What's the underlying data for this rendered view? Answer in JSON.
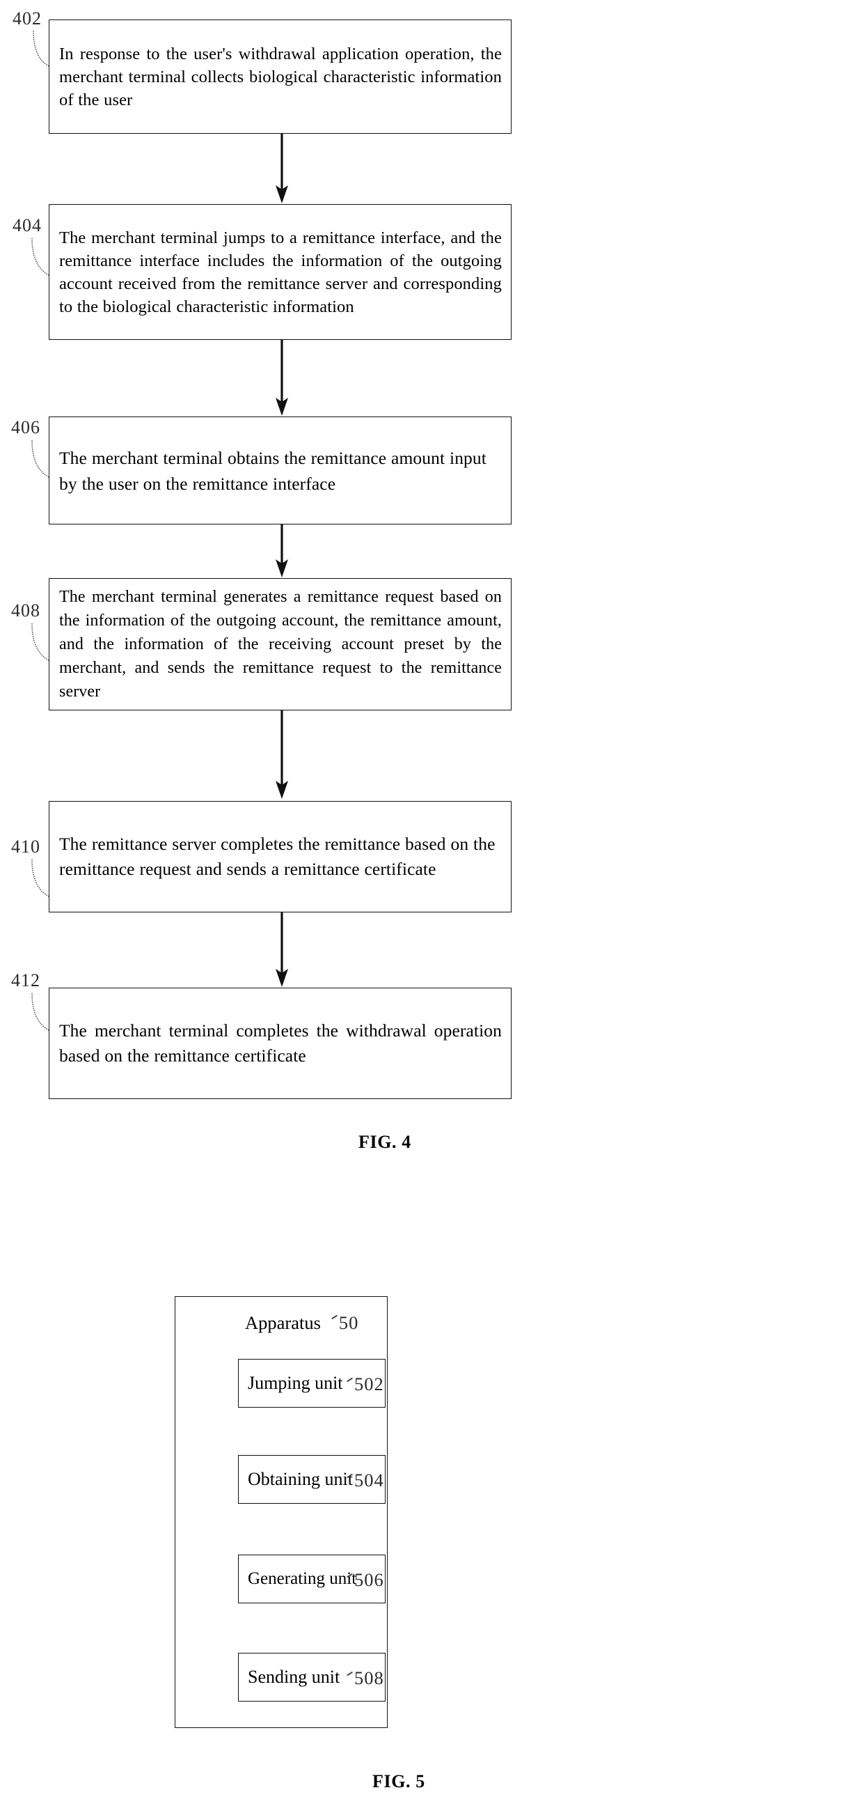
{
  "figure4": {
    "caption": "FIG. 4",
    "steps": [
      {
        "ref": "402",
        "text": "In response to the user's withdrawal application operation, the merchant terminal collects biological characteristic information of the user"
      },
      {
        "ref": "404",
        "text": "The merchant terminal jumps to a remittance interface, and the remittance interface includes the information of the outgoing account received from the remittance server and corresponding to the biological characteristic information"
      },
      {
        "ref": "406",
        "text": "The merchant terminal obtains the remittance amount input by the user on the remittance interface"
      },
      {
        "ref": "408",
        "text": "The merchant terminal generates a remittance request based on the information of the outgoing account, the remittance amount, and the information of the receiving account preset by the merchant, and sends the remittance request to the remittance server"
      },
      {
        "ref": "410",
        "text": "The remittance server completes the remittance based on the remittance request and sends a remittance certificate"
      },
      {
        "ref": "412",
        "text": "The merchant terminal completes the withdrawal operation based on the remittance certificate"
      }
    ]
  },
  "figure5": {
    "caption": "FIG. 5",
    "title": "Apparatus",
    "code": "50",
    "units": [
      {
        "label": "Jumping unit",
        "code": "502"
      },
      {
        "label": "Obtaining unit",
        "code": "504"
      },
      {
        "label": "Generating unit",
        "code": "506"
      },
      {
        "label": "Sending unit",
        "code": "508"
      }
    ]
  }
}
